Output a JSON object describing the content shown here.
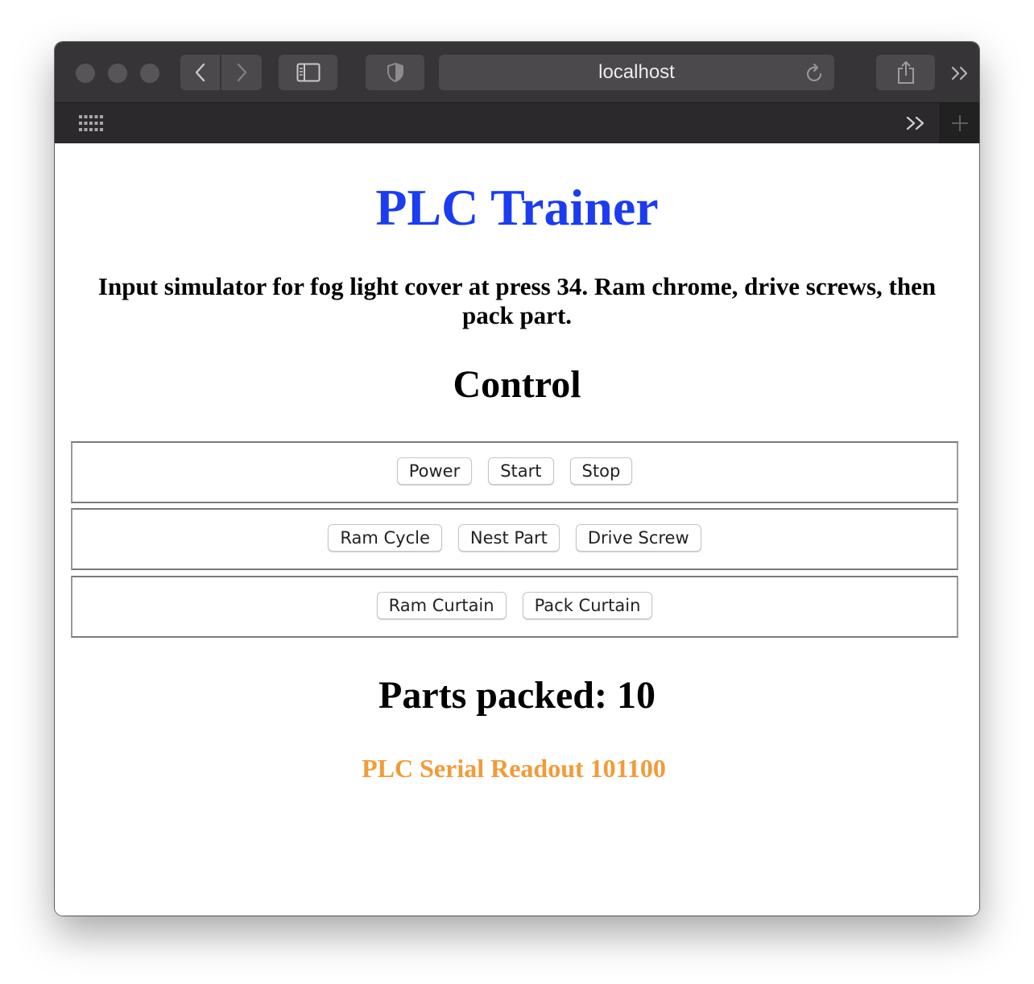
{
  "browser": {
    "address": "localhost",
    "icons": {
      "back": "chevron-left-icon",
      "forward": "chevron-right-icon",
      "sidebar": "sidebar-icon",
      "privacy": "shield-icon",
      "reload": "reload-icon",
      "share": "share-icon",
      "overflow": "double-chevron-right-icon",
      "tab_overview": "grid-icon",
      "new_tab": "plus-icon"
    }
  },
  "page": {
    "title": "PLC Trainer",
    "description": "Input simulator for fog light cover at press 34. Ram chrome, drive screws, then pack part.",
    "control_heading": "Control",
    "control_rows": [
      [
        "Power",
        "Start",
        "Stop"
      ],
      [
        "Ram Cycle",
        "Nest Part",
        "Drive Screw"
      ],
      [
        "Ram Curtain",
        "Pack Curtain"
      ]
    ],
    "parts_packed": "Parts packed: 10",
    "serial_readout": "PLC Serial Readout 101100"
  },
  "colors": {
    "title": "#1c3cf0",
    "serial": "#f29b38",
    "toolbar": "#363436",
    "tabbar": "#2b292b"
  }
}
